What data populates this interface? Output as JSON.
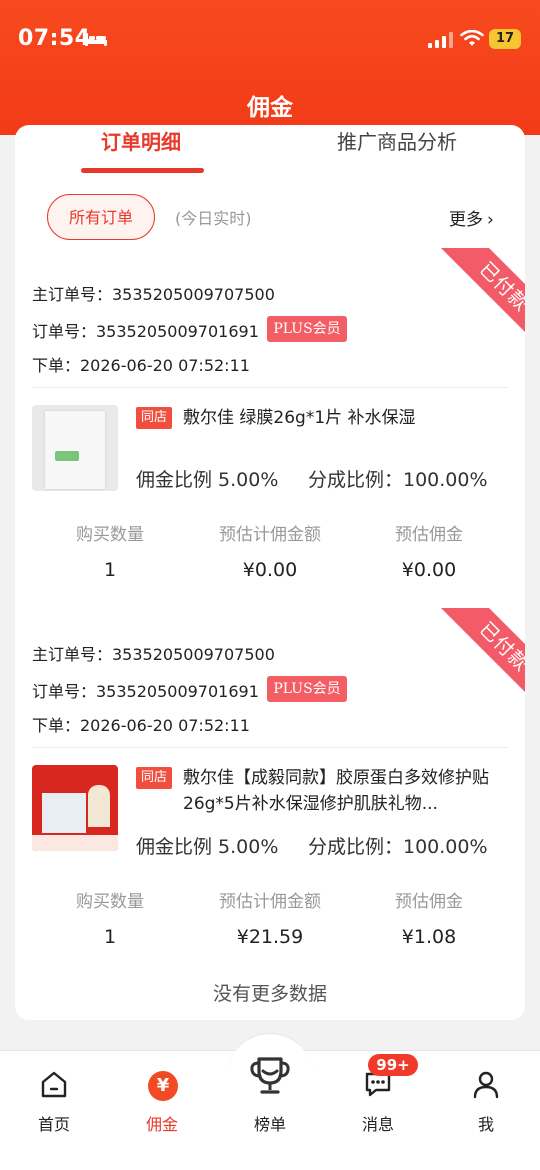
{
  "status_bar": {
    "time": "07:54",
    "battery": "17"
  },
  "header": {
    "title": "佣金"
  },
  "tabs": [
    {
      "label": "订单明细"
    },
    {
      "label": "推广商品分析"
    }
  ],
  "filters": {
    "all_orders": "所有订单",
    "today_realtime": "(今日实时)",
    "more": "更多",
    "more_chevron": "›"
  },
  "orders": [
    {
      "status": "已付款",
      "main_order_no": "主订单号：3535205009707500",
      "order_no": "订单号：3535205009701691",
      "member_badge": "PLUS会员",
      "order_time": "下单：2026-06-20 07:52:11",
      "store_tag": "同店",
      "product_title": "敷尔佳 绿膜26g*1片 补水保湿",
      "commission_rate": "佣金比例 5.00%",
      "split_rate": "分成比例：100.00%",
      "stats": [
        {
          "label": "购买数量",
          "value": "1"
        },
        {
          "label": "预估计佣金额",
          "value": "¥0.00"
        },
        {
          "label": "预估佣金",
          "value": "¥0.00"
        }
      ]
    },
    {
      "status": "已付款",
      "main_order_no": "主订单号：3535205009707500",
      "order_no": "订单号：3535205009701691",
      "member_badge": "PLUS会员",
      "order_time": "下单：2026-06-20 07:52:11",
      "store_tag": "同店",
      "product_title": "敷尔佳【成毅同款】胶原蛋白多效修护贴26g*5片补水保湿修护肌肤礼物...",
      "commission_rate": "佣金比例 5.00%",
      "split_rate": "分成比例：100.00%",
      "stats": [
        {
          "label": "购买数量",
          "value": "1"
        },
        {
          "label": "预估计佣金额",
          "value": "¥21.59"
        },
        {
          "label": "预估佣金",
          "value": "¥1.08"
        }
      ]
    }
  ],
  "footer_note": "没有更多数据",
  "nav": [
    {
      "label": "首页",
      "icon": "home-icon"
    },
    {
      "label": "佣金",
      "icon": "yen-icon",
      "glyph": "¥"
    },
    {
      "label": "榜单",
      "icon": "trophy-icon"
    },
    {
      "label": "消息",
      "icon": "message-icon",
      "badge": "99+"
    },
    {
      "label": "我",
      "icon": "person-icon"
    }
  ],
  "colors": {
    "brand": "#f23a17",
    "accent": "#e8392b",
    "ribbon": "#f45b68",
    "badge": "#f35d64"
  }
}
